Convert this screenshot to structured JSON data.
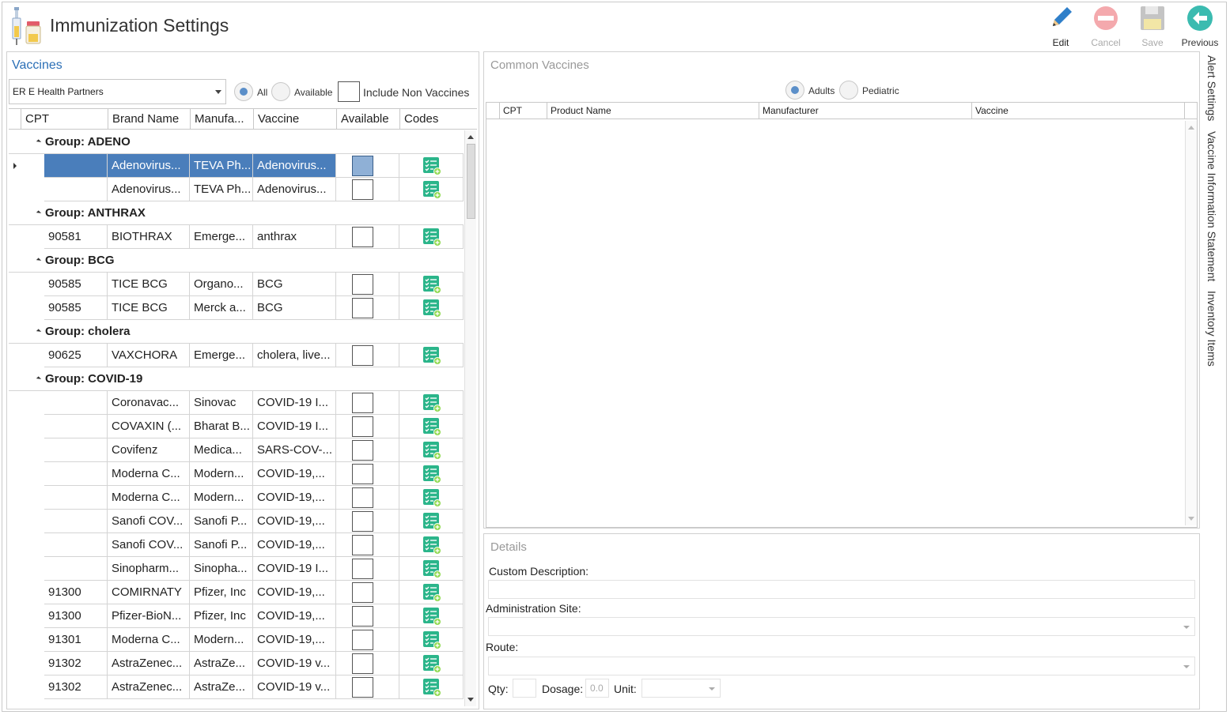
{
  "header": {
    "title": "Immunization Settings",
    "toolbar": {
      "edit": "Edit",
      "cancel": "Cancel",
      "save": "Save",
      "previous": "Previous"
    }
  },
  "vaccines_panel": {
    "title": "Vaccines",
    "practice_select": "ER E Health Partners",
    "filter_all": "All",
    "filter_available": "Available",
    "include_non_vaccines": "Include Non Vaccines",
    "columns": {
      "cpt": "CPT",
      "brand": "Brand Name",
      "manufacturer": "Manufa...",
      "vaccine": "Vaccine",
      "available": "Available",
      "codes": "Codes"
    },
    "groups": [
      {
        "label": "Group: ADENO",
        "rows": [
          {
            "cpt": "",
            "brand": "Adenovirus...",
            "manufacturer": "TEVA Ph...",
            "vaccine": "Adenovirus...",
            "selected": true
          },
          {
            "cpt": "",
            "brand": "Adenovirus...",
            "manufacturer": "TEVA Ph...",
            "vaccine": "Adenovirus..."
          }
        ]
      },
      {
        "label": "Group: ANTHRAX",
        "rows": [
          {
            "cpt": "90581",
            "brand": "BIOTHRAX",
            "manufacturer": "Emerge...",
            "vaccine": "anthrax"
          }
        ]
      },
      {
        "label": "Group: BCG",
        "rows": [
          {
            "cpt": "90585",
            "brand": "TICE BCG",
            "manufacturer": "Organo...",
            "vaccine": "BCG"
          },
          {
            "cpt": "90585",
            "brand": "TICE BCG",
            "manufacturer": "Merck a...",
            "vaccine": "BCG"
          }
        ]
      },
      {
        "label": "Group: cholera",
        "rows": [
          {
            "cpt": "90625",
            "brand": "VAXCHORA",
            "manufacturer": "Emerge...",
            "vaccine": "cholera, live..."
          }
        ]
      },
      {
        "label": "Group: COVID-19",
        "rows": [
          {
            "cpt": "",
            "brand": "Coronavac...",
            "manufacturer": "Sinovac",
            "vaccine": "COVID-19 I..."
          },
          {
            "cpt": "",
            "brand": "COVAXIN (...",
            "manufacturer": "Bharat B...",
            "vaccine": "COVID-19 I..."
          },
          {
            "cpt": "",
            "brand": "Covifenz",
            "manufacturer": "Medica...",
            "vaccine": "SARS-COV-..."
          },
          {
            "cpt": "",
            "brand": "Moderna C...",
            "manufacturer": "Modern...",
            "vaccine": "COVID-19,..."
          },
          {
            "cpt": "",
            "brand": "Moderna C...",
            "manufacturer": "Modern...",
            "vaccine": "COVID-19,..."
          },
          {
            "cpt": "",
            "brand": "Sanofi COV...",
            "manufacturer": "Sanofi P...",
            "vaccine": "COVID-19,..."
          },
          {
            "cpt": "",
            "brand": "Sanofi COV...",
            "manufacturer": "Sanofi P...",
            "vaccine": "COVID-19,..."
          },
          {
            "cpt": "",
            "brand": "Sinopharm...",
            "manufacturer": "Sinopha...",
            "vaccine": "COVID-19 I..."
          },
          {
            "cpt": "91300",
            "brand": "COMIRNATY",
            "manufacturer": "Pfizer, Inc",
            "vaccine": "COVID-19,..."
          },
          {
            "cpt": "91300",
            "brand": "Pfizer-BioN...",
            "manufacturer": "Pfizer, Inc",
            "vaccine": "COVID-19,..."
          },
          {
            "cpt": "91301",
            "brand": "Moderna C...",
            "manufacturer": "Modern...",
            "vaccine": "COVID-19,..."
          },
          {
            "cpt": "91302",
            "brand": "AstraZenec...",
            "manufacturer": "AstraZe...",
            "vaccine": "COVID-19 v..."
          },
          {
            "cpt": "91302",
            "brand": "AstraZenec...",
            "manufacturer": "AstraZe...",
            "vaccine": "COVID-19 v..."
          }
        ]
      }
    ]
  },
  "common_vaccines": {
    "title": "Common Vaccines",
    "adults": "Adults",
    "pediatric": "Pediatric",
    "columns": {
      "cpt": "CPT",
      "product": "Product Name",
      "manufacturer": "Manufacturer",
      "vaccine": "Vaccine"
    }
  },
  "details": {
    "title": "Details",
    "custom_description": "Custom Description:",
    "administration_site": "Administration Site:",
    "route": "Route:",
    "qty": "Qty:",
    "dosage": "Dosage:",
    "dosage_value": "0.0",
    "unit": "Unit:"
  },
  "side_tabs": {
    "alert": "Alert Settings",
    "vis": "Vaccine Information Statement",
    "inventory": "Inventory Items"
  },
  "colors": {
    "selection": "#4a7ebb",
    "accent": "#2b6fb6",
    "codes_icon": "#2bb58a"
  }
}
